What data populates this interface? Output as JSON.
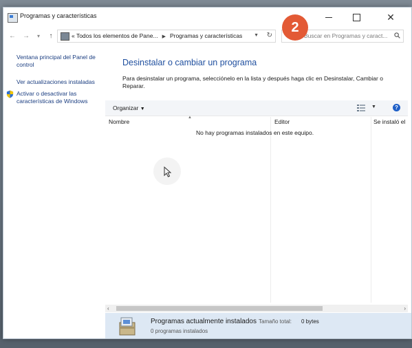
{
  "window": {
    "title": "Programas y características"
  },
  "navigation": {
    "breadcrumb_prefix": "«",
    "breadcrumb": [
      "Todos los elementos de Pane...",
      "Programas y características"
    ],
    "search_placeholder": "Buscar en Programas y caract..."
  },
  "overlay_badge": "2",
  "sidebar": {
    "links": [
      {
        "label": "Ventana principal del Panel de control"
      },
      {
        "label": "Ver actualizaciones instaladas"
      },
      {
        "label": "Activar o desactivar las características de Windows",
        "icon": "shield-icon"
      }
    ]
  },
  "main": {
    "heading": "Desinstalar o cambiar un programa",
    "description": "Para desinstalar un programa, selecciónelo en la lista y después haga clic en Desinstalar, Cambiar o Reparar.",
    "toolbar": {
      "organize_label": "Organizar"
    },
    "columns": [
      "Nombre",
      "Editor",
      "Se instaló el"
    ],
    "empty_message": "No hay programas instalados en este equipo."
  },
  "details_pane": {
    "title": "Programas actualmente instalados",
    "size_label": "Tamaño total:",
    "size_value": "0 bytes",
    "count_text": "0 programas instalados"
  },
  "colors": {
    "heading": "#1e4e9e",
    "link": "#1a3d80",
    "badge": "#e35a35",
    "details_bg": "#dde8f4"
  }
}
